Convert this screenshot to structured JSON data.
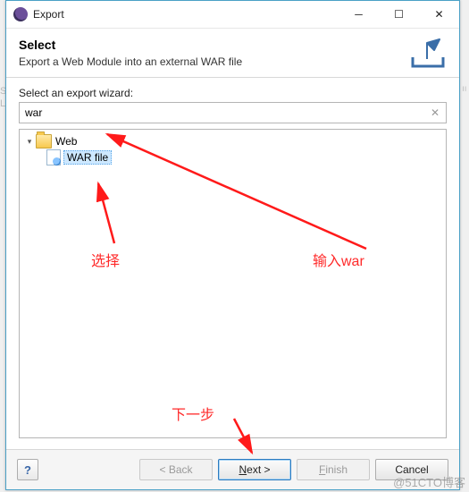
{
  "window": {
    "title": "Export"
  },
  "header": {
    "heading": "Select",
    "description": "Export a Web Module into an external WAR file"
  },
  "wizard": {
    "label": "Select an export wizard:",
    "input_value": "war",
    "tree": {
      "group_label": "Web",
      "item_label": "WAR file"
    }
  },
  "buttons": {
    "back": "< Back",
    "next": "Next >",
    "finish": "Finish",
    "cancel": "Cancel",
    "help": "?"
  },
  "annotations": {
    "select_text": "选择",
    "input_text": "输入war",
    "next_text": "下一步"
  },
  "watermark": "@51CTO博客"
}
